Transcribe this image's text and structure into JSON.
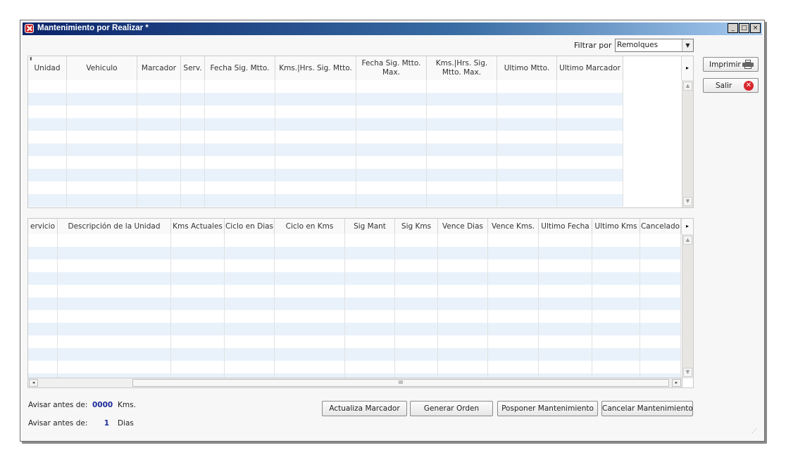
{
  "window": {
    "title": "Mantenimiento por Realizar *",
    "controls": [
      "_",
      "□",
      "×"
    ]
  },
  "filter": {
    "label": "Filtrar por",
    "value": "Remolques"
  },
  "grid1": {
    "sort_indicator": "⬍",
    "columns": [
      "Unidad",
      "Vehiculo",
      "Marcador",
      "Serv.",
      "Fecha Sig. Mtto.",
      "Kms.|Hrs. Sig. Mtto.",
      "Fecha Sig. Mtto. Max.",
      "Kms.|Hrs. Sig. Mtto. Max.",
      "Ultimo Mtto.",
      "Ultimo Marcador"
    ]
  },
  "grid2": {
    "columns": [
      "ervicio",
      "Descripción de la Unidad",
      "Kms Actuales",
      "Ciclo en Dias",
      "Ciclo en Kms",
      "Sig Mant",
      "Sig Kms",
      "Vence Dias",
      "Vence Kms.",
      "Ultimo Fecha",
      "Ultimo Kms",
      "Cancelado"
    ],
    "hscroll_grip": "III"
  },
  "side_buttons": {
    "print": "Imprimir",
    "exit": "Salir"
  },
  "avisar": [
    {
      "label": "Avisar antes de:",
      "value": "0000",
      "unit": "Kms."
    },
    {
      "label": "Avisar antes de:",
      "value": "1",
      "unit": "Dias"
    }
  ],
  "actions": {
    "update": "Actualiza Marcador",
    "generate": "Generar Orden",
    "postpone": "Posponer Mantenimiento",
    "cancel": "Cancelar Mantenimiento"
  },
  "colors": {
    "title_start": "#0a246a",
    "title_end": "#a6caf0",
    "row_alt": "#e9f2fb",
    "value_blue": "#1a2a9a"
  }
}
